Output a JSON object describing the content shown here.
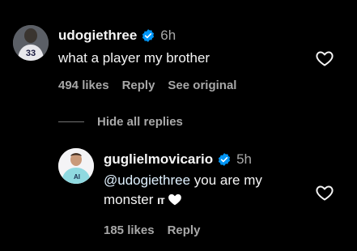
{
  "comment": {
    "username": "udogiethree",
    "time": "6h",
    "text": "what a player my brother",
    "likes": "494 likes",
    "reply_label": "Reply",
    "see_original_label": "See original",
    "avatar_jersey": "33"
  },
  "hide_replies_label": "Hide all replies",
  "reply": {
    "username": "guglielmovicario",
    "time": "5h",
    "mention": "@udogiethree",
    "text_after_mention": " you are my monster ",
    "team_mark": "ıт",
    "likes": "185 likes",
    "reply_label": "Reply",
    "avatar_shirt_text": "AI"
  },
  "colors": {
    "background": "#000000",
    "primary_text": "#f5f5f5",
    "secondary_text": "#a8a8a8",
    "verified_blue": "#0095f6"
  },
  "icons": {
    "verified": "verified-badge-icon",
    "like": "heart-outline-icon",
    "emoji": "white-heart-icon"
  }
}
